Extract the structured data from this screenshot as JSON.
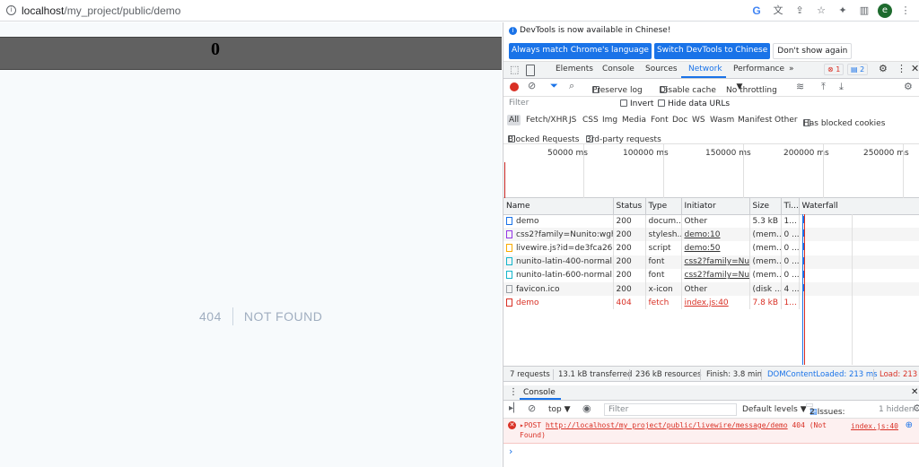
{
  "browser": {
    "url_host": "localhost",
    "url_path": "/my_project/public/demo",
    "profile_initial": "e"
  },
  "page": {
    "counter": "0",
    "error_code": "404",
    "error_message": "NOT FOUND"
  },
  "devtools": {
    "infobar": {
      "message": "DevTools is now available in Chinese!",
      "btn_match": "Always match Chrome's language",
      "btn_switch": "Switch DevTools to Chinese",
      "btn_dismiss": "Don't show again"
    },
    "tabs": [
      "Elements",
      "Console",
      "Sources",
      "Network",
      "Performance"
    ],
    "more_tabs": "»",
    "error_count": "1",
    "message_count": "2",
    "toolbar": {
      "preserve_log": "Preserve log",
      "disable_cache": "Disable cache",
      "throttling": "No throttling"
    },
    "filter": {
      "placeholder": "Filter",
      "invert": "Invert",
      "hide_data_urls": "Hide data URLs"
    },
    "types": [
      "All",
      "Fetch/XHR",
      "JS",
      "CSS",
      "Img",
      "Media",
      "Font",
      "Doc",
      "WS",
      "Wasm",
      "Manifest",
      "Other"
    ],
    "has_blocked_cookies": "Has blocked cookies",
    "blocked_requests": "Blocked Requests",
    "third_party": "3rd-party requests",
    "overview_ticks": [
      "50000 ms",
      "100000 ms",
      "150000 ms",
      "200000 ms",
      "250000 ms"
    ],
    "columns": [
      "Name",
      "Status",
      "Type",
      "Initiator",
      "Size",
      "Ti...",
      "Waterfall"
    ],
    "requests": [
      {
        "name": "demo",
        "status": "200",
        "type": "docum...",
        "initiator": "Other",
        "size": "5.3 kB",
        "time": "1..."
      },
      {
        "name": "css2?family=Nunito:wgh...",
        "status": "200",
        "type": "stylesh...",
        "initiator": "demo:10",
        "size": "(mem...",
        "time": "0 ..."
      },
      {
        "name": "livewire.js?id=de3fca266...",
        "status": "200",
        "type": "script",
        "initiator": "demo:50",
        "size": "(mem...",
        "time": "0 ..."
      },
      {
        "name": "nunito-latin-400-normal...",
        "status": "200",
        "type": "font",
        "initiator": "css2?family=Nu...",
        "size": "(mem...",
        "time": "0 ..."
      },
      {
        "name": "nunito-latin-600-normal...",
        "status": "200",
        "type": "font",
        "initiator": "css2?family=Nu...",
        "size": "(mem...",
        "time": "0 ..."
      },
      {
        "name": "favicon.ico",
        "status": "200",
        "type": "x-icon",
        "initiator": "Other",
        "size": "(disk ...",
        "time": "4 ..."
      },
      {
        "name": "demo",
        "status": "404",
        "type": "fetch",
        "initiator": "index.js:40",
        "size": "7.8 kB",
        "time": "1..."
      }
    ],
    "summary": {
      "requests": "7 requests",
      "transferred": "13.1 kB transferred",
      "resources": "236 kB resources",
      "finish": "Finish: 3.8 min",
      "dcl": "DOMContentLoaded: 213 ms",
      "load": "Load: 213 m"
    },
    "drawer": {
      "tab": "Console",
      "context": "top ▼",
      "filter_placeholder": "Filter",
      "levels": "Default levels ▼",
      "issues": "2 Issues:",
      "issues_count": "2",
      "hidden": "1 hidden"
    },
    "console_error": {
      "prefix": "▸POST",
      "url": "http://localhost/my_project/public/livewire/message/demo",
      "status": "404 (Not",
      "status2": "Found)",
      "source": "index.js:40"
    },
    "prompt": "›"
  }
}
